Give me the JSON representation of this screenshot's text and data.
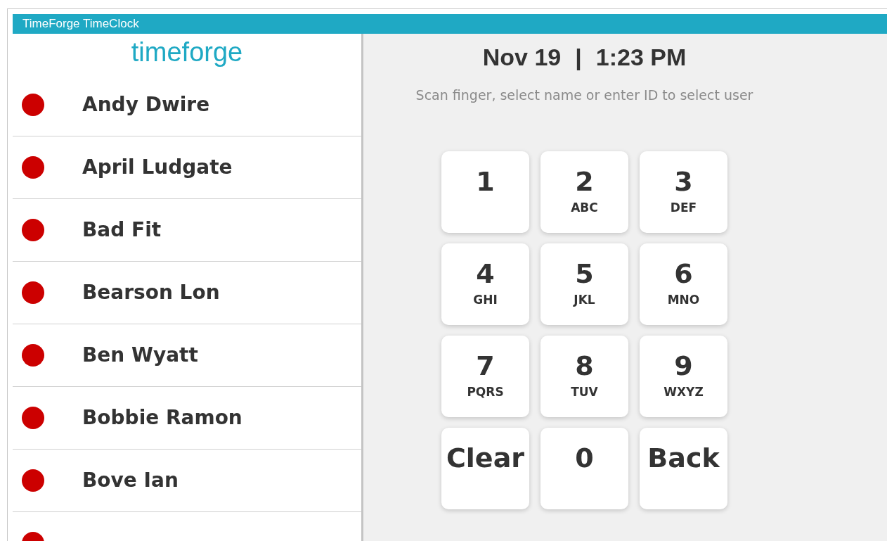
{
  "window": {
    "title": "TimeForge TimeClock"
  },
  "logo": "timeforge",
  "employees": [
    {
      "name": "Andy Dwire",
      "color": "#cc0000"
    },
    {
      "name": "April Ludgate",
      "color": "#cc0000"
    },
    {
      "name": "Bad Fit",
      "color": "#cc0000"
    },
    {
      "name": "Bearson Lon",
      "color": "#cc0000"
    },
    {
      "name": "Ben Wyatt",
      "color": "#cc0000"
    },
    {
      "name": "Bobbie Ramon",
      "color": "#cc0000"
    },
    {
      "name": "Bove Ian",
      "color": "#cc0000"
    },
    {
      "color": "#cc0000"
    }
  ],
  "clock": {
    "date": "Nov 19",
    "separator": "|",
    "time": "1:23 PM"
  },
  "hint": "Scan finger, select name or enter ID to select user",
  "keypad": [
    {
      "main": "1"
    },
    {
      "main": "2",
      "sub": "ABC"
    },
    {
      "main": "3",
      "sub": "DEF"
    },
    {
      "main": "4",
      "sub": "GHI"
    },
    {
      "main": "5",
      "sub": "JKL"
    },
    {
      "main": "6",
      "sub": "MNO"
    },
    {
      "main": "7",
      "sub": "PQRS"
    },
    {
      "main": "8",
      "sub": "TUV"
    },
    {
      "main": "9",
      "sub": "WXYZ"
    },
    {
      "main": "Clear"
    },
    {
      "main": "0"
    },
    {
      "main": "Back"
    }
  ]
}
